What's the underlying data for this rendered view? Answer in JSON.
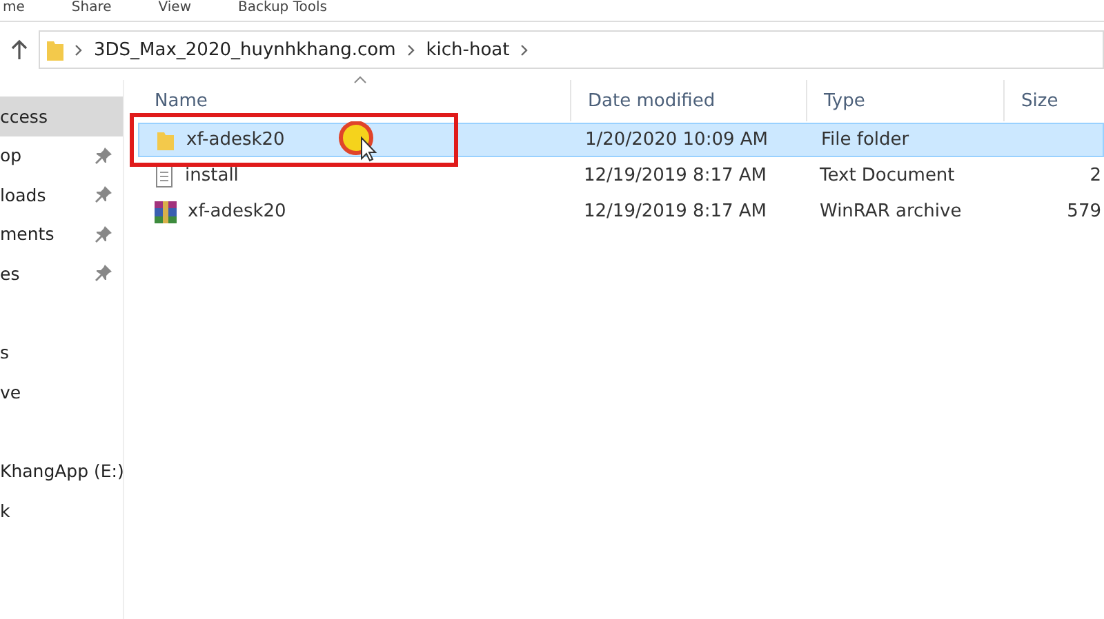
{
  "ribbon_tabs": [
    {
      "label": "me"
    },
    {
      "label": "Share"
    },
    {
      "label": "View"
    },
    {
      "label": "Backup Tools"
    }
  ],
  "address_bar": {
    "segments": [
      "3DS_Max_2020_huynhkhang.com",
      "kich-hoat"
    ]
  },
  "sidebar": {
    "groups": [
      {
        "items": [
          {
            "label": "ccess",
            "selected": true,
            "pinned": false
          },
          {
            "label": "op",
            "selected": false,
            "pinned": true
          },
          {
            "label": "loads",
            "selected": false,
            "pinned": true
          },
          {
            "label": "ments",
            "selected": false,
            "pinned": true
          },
          {
            "label": "es",
            "selected": false,
            "pinned": true
          }
        ]
      },
      {
        "items": [
          {
            "label": "s",
            "selected": false,
            "pinned": false
          },
          {
            "label": "ve",
            "selected": false,
            "pinned": false
          }
        ]
      },
      {
        "items": [
          {
            "label": "KhangApp (E:)",
            "selected": false,
            "pinned": false
          },
          {
            "label": "k",
            "selected": false,
            "pinned": false
          }
        ]
      }
    ]
  },
  "table": {
    "columns": [
      "Name",
      "Date modified",
      "Type",
      "Size"
    ],
    "rows": [
      {
        "kind": "folder",
        "name": "xf-adesk20",
        "date": "1/20/2020 10:09 AM",
        "type": "File folder",
        "size": "",
        "selected": true,
        "highlighted": true
      },
      {
        "kind": "text",
        "name": "install",
        "date": "12/19/2019 8:17 AM",
        "type": "Text Document",
        "size": "2",
        "selected": false,
        "highlighted": false
      },
      {
        "kind": "archive",
        "name": "xf-adesk20",
        "date": "12/19/2019 8:17 AM",
        "type": "WinRAR archive",
        "size": "579",
        "selected": false,
        "highlighted": false
      }
    ]
  }
}
